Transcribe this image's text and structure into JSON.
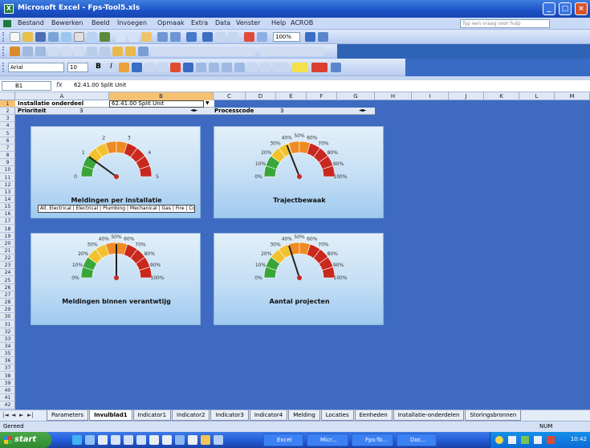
{
  "window": {
    "title": "Microsoft Excel - Fps-Tool5.xls",
    "app_icon": "excel-icon",
    "controls": [
      "minimize-icon",
      "maximize-icon",
      "close-icon"
    ]
  },
  "menu": {
    "items": [
      "Bestand",
      "Bewerken",
      "Beeld",
      "Invoegen",
      "Opmaak",
      "Extra",
      "Data",
      "Venster",
      "Help",
      "ACROB"
    ],
    "help_placeholder": "Typ een vraag voor hulp"
  },
  "toolbar": {
    "zoom": "100%",
    "font_name": "Arial",
    "font_size": "10"
  },
  "formula_bar": {
    "name_box": "B1",
    "fx_label": "fx",
    "value": "62.41.00 Split Unit"
  },
  "columns": [
    "A",
    "B",
    "C",
    "D",
    "E",
    "F",
    "G",
    "H",
    "I",
    "J",
    "K",
    "L",
    "M"
  ],
  "rows": [
    "1",
    "2",
    "3",
    "4",
    "5",
    "6",
    "7",
    "8",
    "9",
    "10",
    "11",
    "12",
    "13",
    "14",
    "15",
    "16",
    "17",
    "18",
    "19",
    "20",
    "21",
    "22",
    "23",
    "24",
    "25",
    "26",
    "27",
    "28",
    "29",
    "30",
    "31",
    "32",
    "33",
    "34",
    "35",
    "36",
    "37",
    "38",
    "39",
    "40",
    "41",
    "42"
  ],
  "sheet": {
    "installatie_label": "Installatie onderdeel",
    "installatie_value": "62.41.00 Split Unit",
    "prioriteit_label": "Prioriteit",
    "prioriteit_value": "3",
    "processcode_label": "Processcode",
    "processcode_value": "3"
  },
  "gauges": [
    {
      "title": "Meldingen per installatie",
      "ticks": [
        "0",
        "1",
        "2",
        "3",
        "4",
        "5"
      ],
      "value_fraction": 0.2,
      "select_text": "All. Electrical | Electrical | Plumbing | Mechanical | Gas | Fire | Cooling | Heating | Sanitair | Elevator | Overig"
    },
    {
      "title": "Trajectbewaak",
      "ticks": [
        "0%",
        "10%",
        "20%",
        "30%",
        "40%",
        "50%",
        "60%",
        "70%",
        "80%",
        "90%",
        "100%"
      ],
      "value_fraction": 0.38,
      "select_text": ""
    },
    {
      "title": "Meldingen binnen verantwtijg",
      "ticks": [
        "0%",
        "10%",
        "20%",
        "30%",
        "40%",
        "50%",
        "60%",
        "70%",
        "80%",
        "90%",
        "100%"
      ],
      "value_fraction": 0.5,
      "select_text": ""
    },
    {
      "title": "Aantal projecten",
      "ticks": [
        "0%",
        "10%",
        "20%",
        "30%",
        "40%",
        "50%",
        "60%",
        "70%",
        "80%",
        "90%",
        "100%"
      ],
      "value_fraction": 0.4,
      "select_text": ""
    }
  ],
  "sheet_tabs": [
    "Parameters",
    "Invulblad1",
    "Indicator1",
    "Indicator2",
    "Indicator3",
    "Indicator4",
    "Melding",
    "Locaties",
    "Eenheden",
    "Installatie-onderdelen",
    "Storingsbronnen"
  ],
  "active_tab_index": 1,
  "status": {
    "left": "Gereed",
    "right": "NUM"
  },
  "taskbar": {
    "start_label": "start",
    "tasks": [
      "Excel",
      "Micr...",
      "Fps-To...",
      "Doc..."
    ],
    "clock": "10:42"
  },
  "colors": {
    "gauge_green": "#3aa63a",
    "gauge_yellow": "#f2c12e",
    "gauge_orange": "#ef8a24",
    "gauge_red": "#c9281f",
    "sheet_background": "#3e6bc1",
    "taskbar": "#245edb"
  }
}
